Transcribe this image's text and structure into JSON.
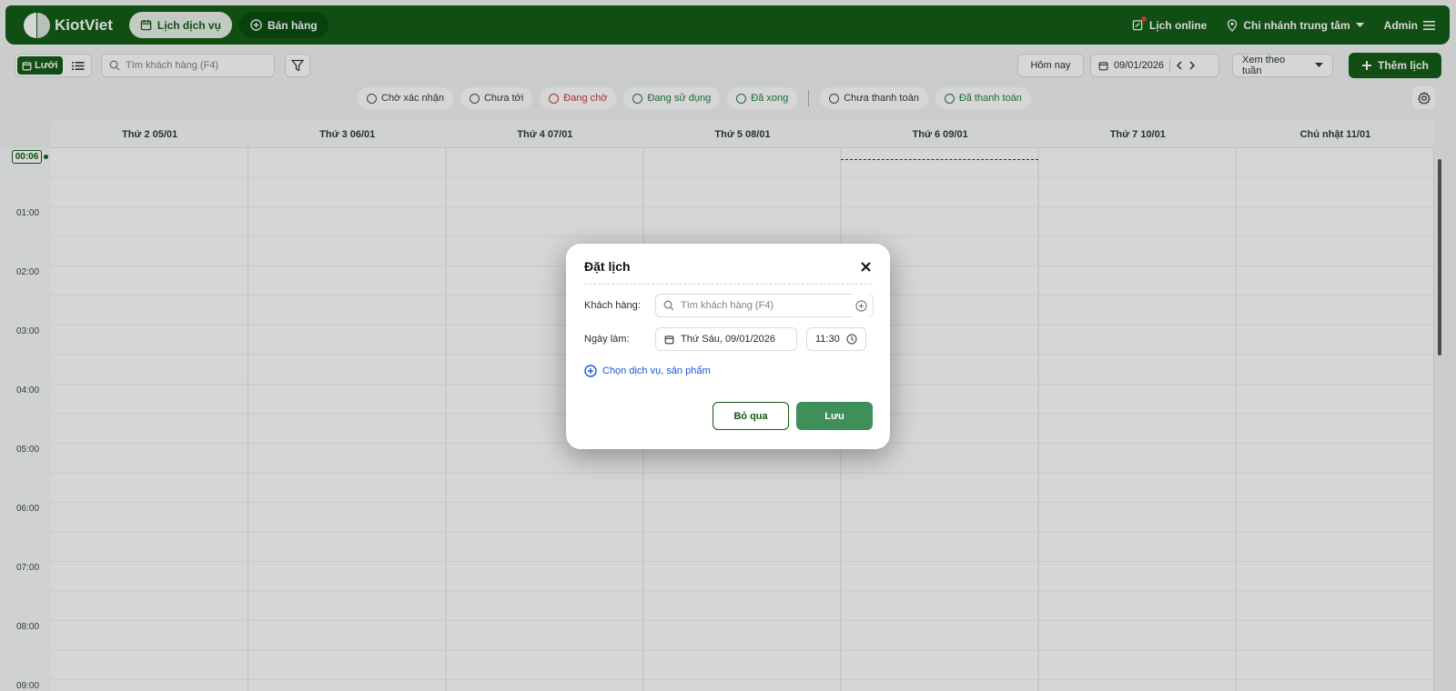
{
  "app": {
    "name": "KiotViet",
    "nav": [
      {
        "label": "Lịch dịch vụ",
        "active": true
      },
      {
        "label": "Bán hàng",
        "active": false
      }
    ],
    "right": {
      "online": "Lịch online",
      "branch": "Chi nhánh trung tâm",
      "user": "Admin"
    }
  },
  "toolbar": {
    "view_grid": "Lưới",
    "search_placeholder": "Tìm khách hàng (F4)",
    "today": "Hôm nay",
    "current_date": "09/01/2026",
    "view_mode": "Xem theo tuần",
    "add_label": "Thêm lịch"
  },
  "statuses": [
    {
      "label": "Chờ xác nhận",
      "color": "#4a4a4a"
    },
    {
      "label": "Chưa tới",
      "color": "#4a4a4a"
    },
    {
      "label": "Đang chờ",
      "color": "#c0392b"
    },
    {
      "label": "Đang sử dụng",
      "color": "#1b7a3c"
    },
    {
      "label": "Đã xong",
      "color": "#1b7a3c"
    },
    {
      "label": "Chưa thanh toán",
      "color": "#4a4a4a"
    },
    {
      "label": "Đã thanh toán",
      "color": "#1b7a3c"
    }
  ],
  "calendar": {
    "days": [
      "Thứ 2 05/01",
      "Thứ 3 06/01",
      "Thứ 4 07/01",
      "Thứ 5 08/01",
      "Thứ 6 09/01",
      "Thứ 7 10/01",
      "Chủ nhật 11/01"
    ],
    "now_label": "00:06",
    "hours": [
      "01:00",
      "02:00",
      "03:00",
      "04:00",
      "05:00",
      "06:00",
      "07:00",
      "08:00",
      "09:00"
    ]
  },
  "modal": {
    "title": "Đặt lịch",
    "customer_label": "Khách hàng:",
    "customer_placeholder": "Tìm khách hàng (F4)",
    "date_label": "Ngày làm:",
    "date_value": "Thứ Sáu, 09/01/2026",
    "time_value": "11:30",
    "add_service": "Chọn dịch vụ, sản phẩm",
    "cancel": "Bỏ qua",
    "save": "Lưu"
  },
  "colors": {
    "brand": "#0e5a12",
    "link": "#1a56db",
    "save": "#3f8f5a"
  }
}
